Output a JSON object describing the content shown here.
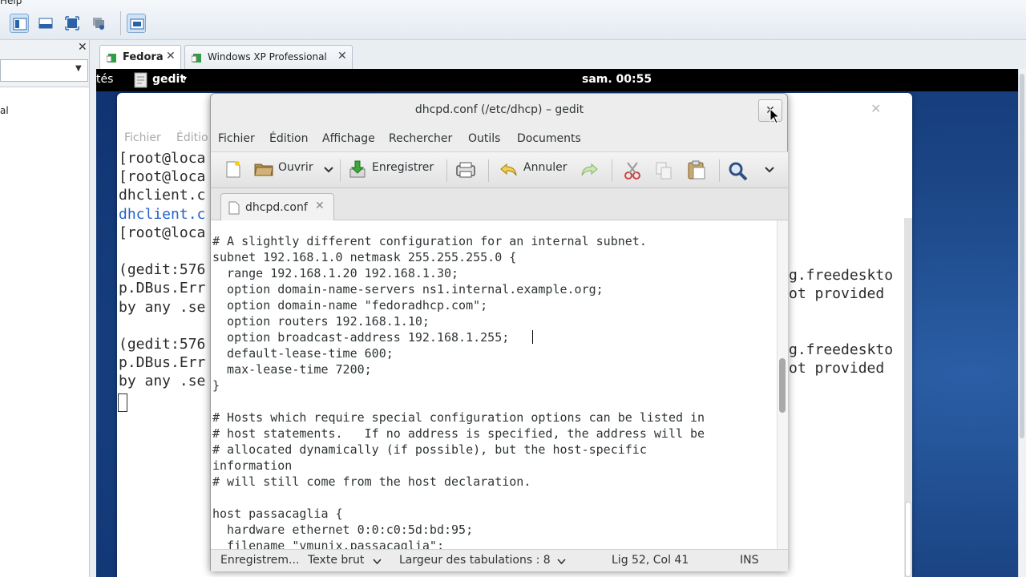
{
  "host": {
    "menu_help": "Help",
    "left_panel": {
      "close": "✕",
      "item": "al"
    },
    "vm_tabs": [
      {
        "label": "Fedora",
        "close": "✕"
      },
      {
        "label": "Windows XP Professional",
        "close": "✕"
      }
    ]
  },
  "guest": {
    "topbar": {
      "activities": "tés",
      "app_menu": "gedit",
      "app_menu_arrow": "▾",
      "clock": "sam. 00:55"
    },
    "terminal": {
      "menu": [
        "Fichier",
        "Éditio"
      ],
      "lines": [
        "[root@loca",
        "[root@loca",
        "dhclient.c",
        "dhclient.c",
        "[root@loca",
        "",
        "(gedit:576",
        "p.DBus.Err",
        "by any .se",
        "",
        "(gedit:576",
        "p.DBus.Err",
        "by any .se"
      ],
      "right_lines": [
        "g.freedeskto",
        "ot provided",
        "",
        "",
        "g.freedeskto",
        "ot provided"
      ]
    }
  },
  "gedit": {
    "title": "dhcpd.conf (/etc/dhcp) – gedit",
    "close": "✕",
    "menu": [
      "Fichier",
      "Édition",
      "Affichage",
      "Rechercher",
      "Outils",
      "Documents"
    ],
    "toolbar": {
      "open": "Ouvrir",
      "save": "Enregistrer",
      "undo": "Annuler"
    },
    "tab": {
      "label": "dhcpd.conf",
      "close": "✕"
    },
    "code_lines": [
      "# A slightly different configuration for an internal subnet.",
      "subnet 192.168.1.0 netmask 255.255.255.0 {",
      "  range 192.168.1.20 192.168.1.30;",
      "  option domain-name-servers ns1.internal.example.org;",
      "  option domain-name \"fedoradhcp.com\";",
      "  option routers 192.168.1.10;",
      "  option broadcast-address 192.168.1.255;",
      "  default-lease-time 600;",
      "  max-lease-time 7200;",
      "}",
      "",
      "# Hosts which require special configuration options can be listed in",
      "# host statements.   If no address is specified, the address will be",
      "# allocated dynamically (if possible), but the host-specific",
      "information",
      "# will still come from the host declaration.",
      "",
      "host passacaglia {",
      "  hardware ethernet 0:0:c0:5d:bd:95;",
      "  filename \"vmunix.passacaglia\";"
    ],
    "status": {
      "save_state": "Enregistrem...",
      "lang": "Texte brut",
      "tab_width": "Largeur des tabulations : 8",
      "position": "Lig 52, Col 41",
      "mode": "INS"
    }
  }
}
